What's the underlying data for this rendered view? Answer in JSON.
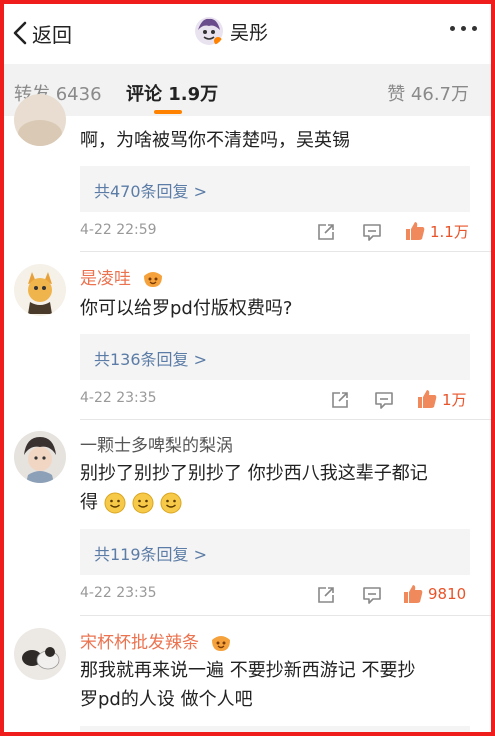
{
  "header": {
    "back_label": "返回",
    "title": "吴彤"
  },
  "tabs": {
    "repost": "转发 6436",
    "comment": "评论 1.9万",
    "like": "赞 46.7万"
  },
  "colors": {
    "accent": "#ff8200",
    "border": "#f01d1d",
    "link": "#5b7ca6",
    "username": "#eb7350",
    "like": "#e8542a"
  },
  "comments": [
    {
      "username": "",
      "text": "啊，为啥被骂你不清楚吗，吴英锡",
      "replies": "共470条回复 >",
      "time": "4-22 22:59",
      "likes": "1.1万"
    },
    {
      "username": "是凌哇",
      "text": "你可以给罗pd付版权费吗?",
      "replies": "共136条回复 >",
      "time": "4-22 23:35",
      "likes": "1万"
    },
    {
      "username": "一颗士多啤梨的梨涡",
      "text_line1": "别抄了别抄了别抄了 你抄西八我这辈子都记",
      "text_line2": "得",
      "replies": "共119条回复 >",
      "time": "4-22 23:35",
      "likes": "9810"
    },
    {
      "username": "宋杯杯批发辣条",
      "text_line1": "那我就再来说一遍 不要抄新西游记 不要抄",
      "text_line2": "罗pd的人设 做个人吧"
    }
  ],
  "icons": [
    "back-chevron-icon",
    "more-icon",
    "share-icon",
    "comment-icon",
    "like-icon",
    "vip-icon",
    "smile-emoji-icon"
  ]
}
